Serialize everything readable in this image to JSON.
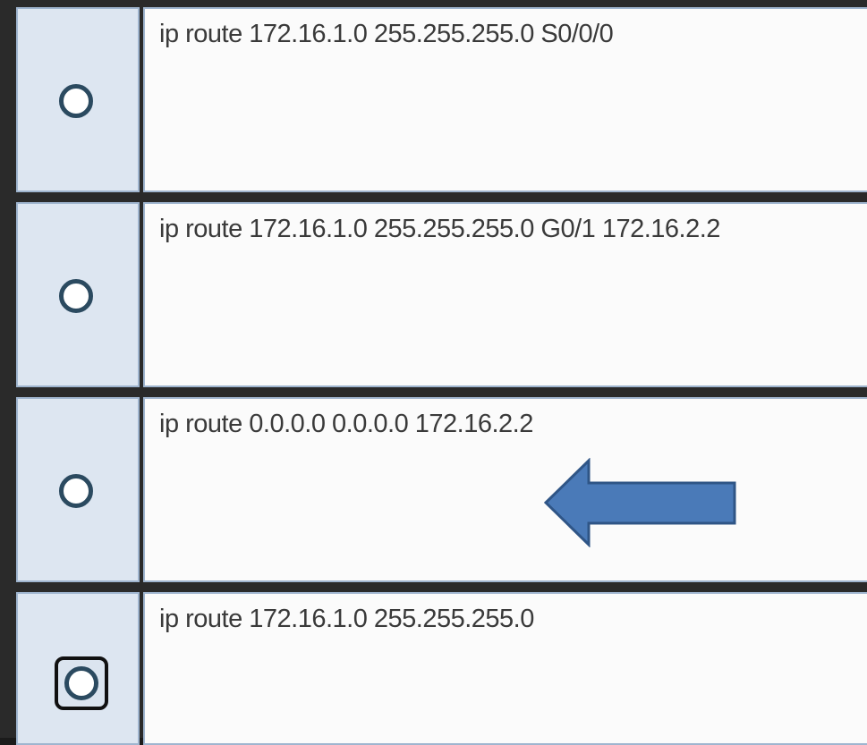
{
  "question": {
    "options": [
      {
        "label": "ip route 172.16.1.0 255.255.255.0 S0/0/0",
        "selected": false,
        "focused": false
      },
      {
        "label": "ip route 172.16.1.0 255.255.255.0 G0/1 172.16.2.2",
        "selected": false,
        "focused": false
      },
      {
        "label": "ip route 0.0.0.0 0.0.0.0 172.16.2.2",
        "selected": false,
        "focused": false
      },
      {
        "label": "ip route 172.16.1.0 255.255.255.0",
        "selected": false,
        "focused": true
      }
    ]
  },
  "annotation": {
    "pointer_icon": "left-arrow-icon",
    "pointer_color": "#4a7ab8",
    "points_to_option": 3
  }
}
